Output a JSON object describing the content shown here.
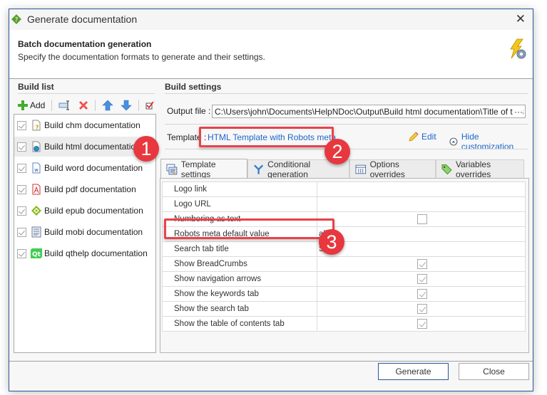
{
  "window": {
    "title": "Generate documentation",
    "close_icon": "close-icon",
    "app_icon": "helpndoc-diamond-icon"
  },
  "header": {
    "title": "Batch documentation generation",
    "subtitle": "Specify the documentation formats to generate and their settings.",
    "icon": "lightning-gear-icon"
  },
  "build_list": {
    "section_title": "Build list",
    "toolbar": {
      "add_label": "Add",
      "add_icon": "plus-icon",
      "rename_icon": "rename-icon",
      "delete_icon": "delete-icon",
      "move_up_icon": "arrow-up-icon",
      "move_down_icon": "arrow-down-icon",
      "check_all_icon": "check-all-icon"
    },
    "items": [
      {
        "label": "Build chm documentation",
        "checked": true,
        "icon": "chm-icon"
      },
      {
        "label": "Build html documentation",
        "checked": true,
        "icon": "html-icon",
        "selected": true
      },
      {
        "label": "Build word documentation",
        "checked": true,
        "icon": "word-icon"
      },
      {
        "label": "Build pdf documentation",
        "checked": true,
        "icon": "pdf-icon"
      },
      {
        "label": "Build epub documentation",
        "checked": true,
        "icon": "epub-icon"
      },
      {
        "label": "Build mobi documentation",
        "checked": true,
        "icon": "mobi-icon"
      },
      {
        "label": "Build qthelp documentation",
        "checked": true,
        "icon": "qt-icon"
      }
    ]
  },
  "build_settings": {
    "section_title": "Build settings",
    "output_label": "Output file :",
    "output_value": "C:\\Users\\john\\Documents\\HelpNDoc\\Output\\Build html documentation\\Title of this help p",
    "output_browse": "···",
    "template_label": "Template :",
    "template_value": "HTML Template with Robots meta",
    "edit_label": "Edit",
    "hide_customization_label": "Hide customization"
  },
  "tabs": [
    {
      "label": "Template settings",
      "icon": "template-settings-icon",
      "active": true
    },
    {
      "label": "Conditional generation",
      "icon": "conditional-icon",
      "active": false
    },
    {
      "label": "Options overrides",
      "icon": "options-icon",
      "active": false
    },
    {
      "label": "Variables overrides",
      "icon": "variables-tag-icon",
      "active": false
    }
  ],
  "template_settings": [
    {
      "name": "Logo link",
      "value": ""
    },
    {
      "name": "Logo URL",
      "value": ""
    },
    {
      "name": "Numbering as text",
      "type": "checkbox",
      "checked": false
    },
    {
      "name": "Robots meta default value",
      "value": "all"
    },
    {
      "name": "Search tab title",
      "value": "Sea"
    },
    {
      "name": "Show BreadCrumbs",
      "type": "checkbox",
      "checked": true
    },
    {
      "name": "Show navigation arrows",
      "type": "checkbox",
      "checked": true
    },
    {
      "name": "Show the keywords tab",
      "type": "checkbox",
      "checked": true
    },
    {
      "name": "Show the search tab",
      "type": "checkbox",
      "checked": true
    },
    {
      "name": "Show the table of contents tab",
      "type": "checkbox",
      "checked": true
    }
  ],
  "footer": {
    "generate_label": "Generate",
    "close_label": "Close"
  },
  "annotations": {
    "badge1": "1",
    "badge2": "2",
    "badge3": "3",
    "color": "#e8373e"
  }
}
